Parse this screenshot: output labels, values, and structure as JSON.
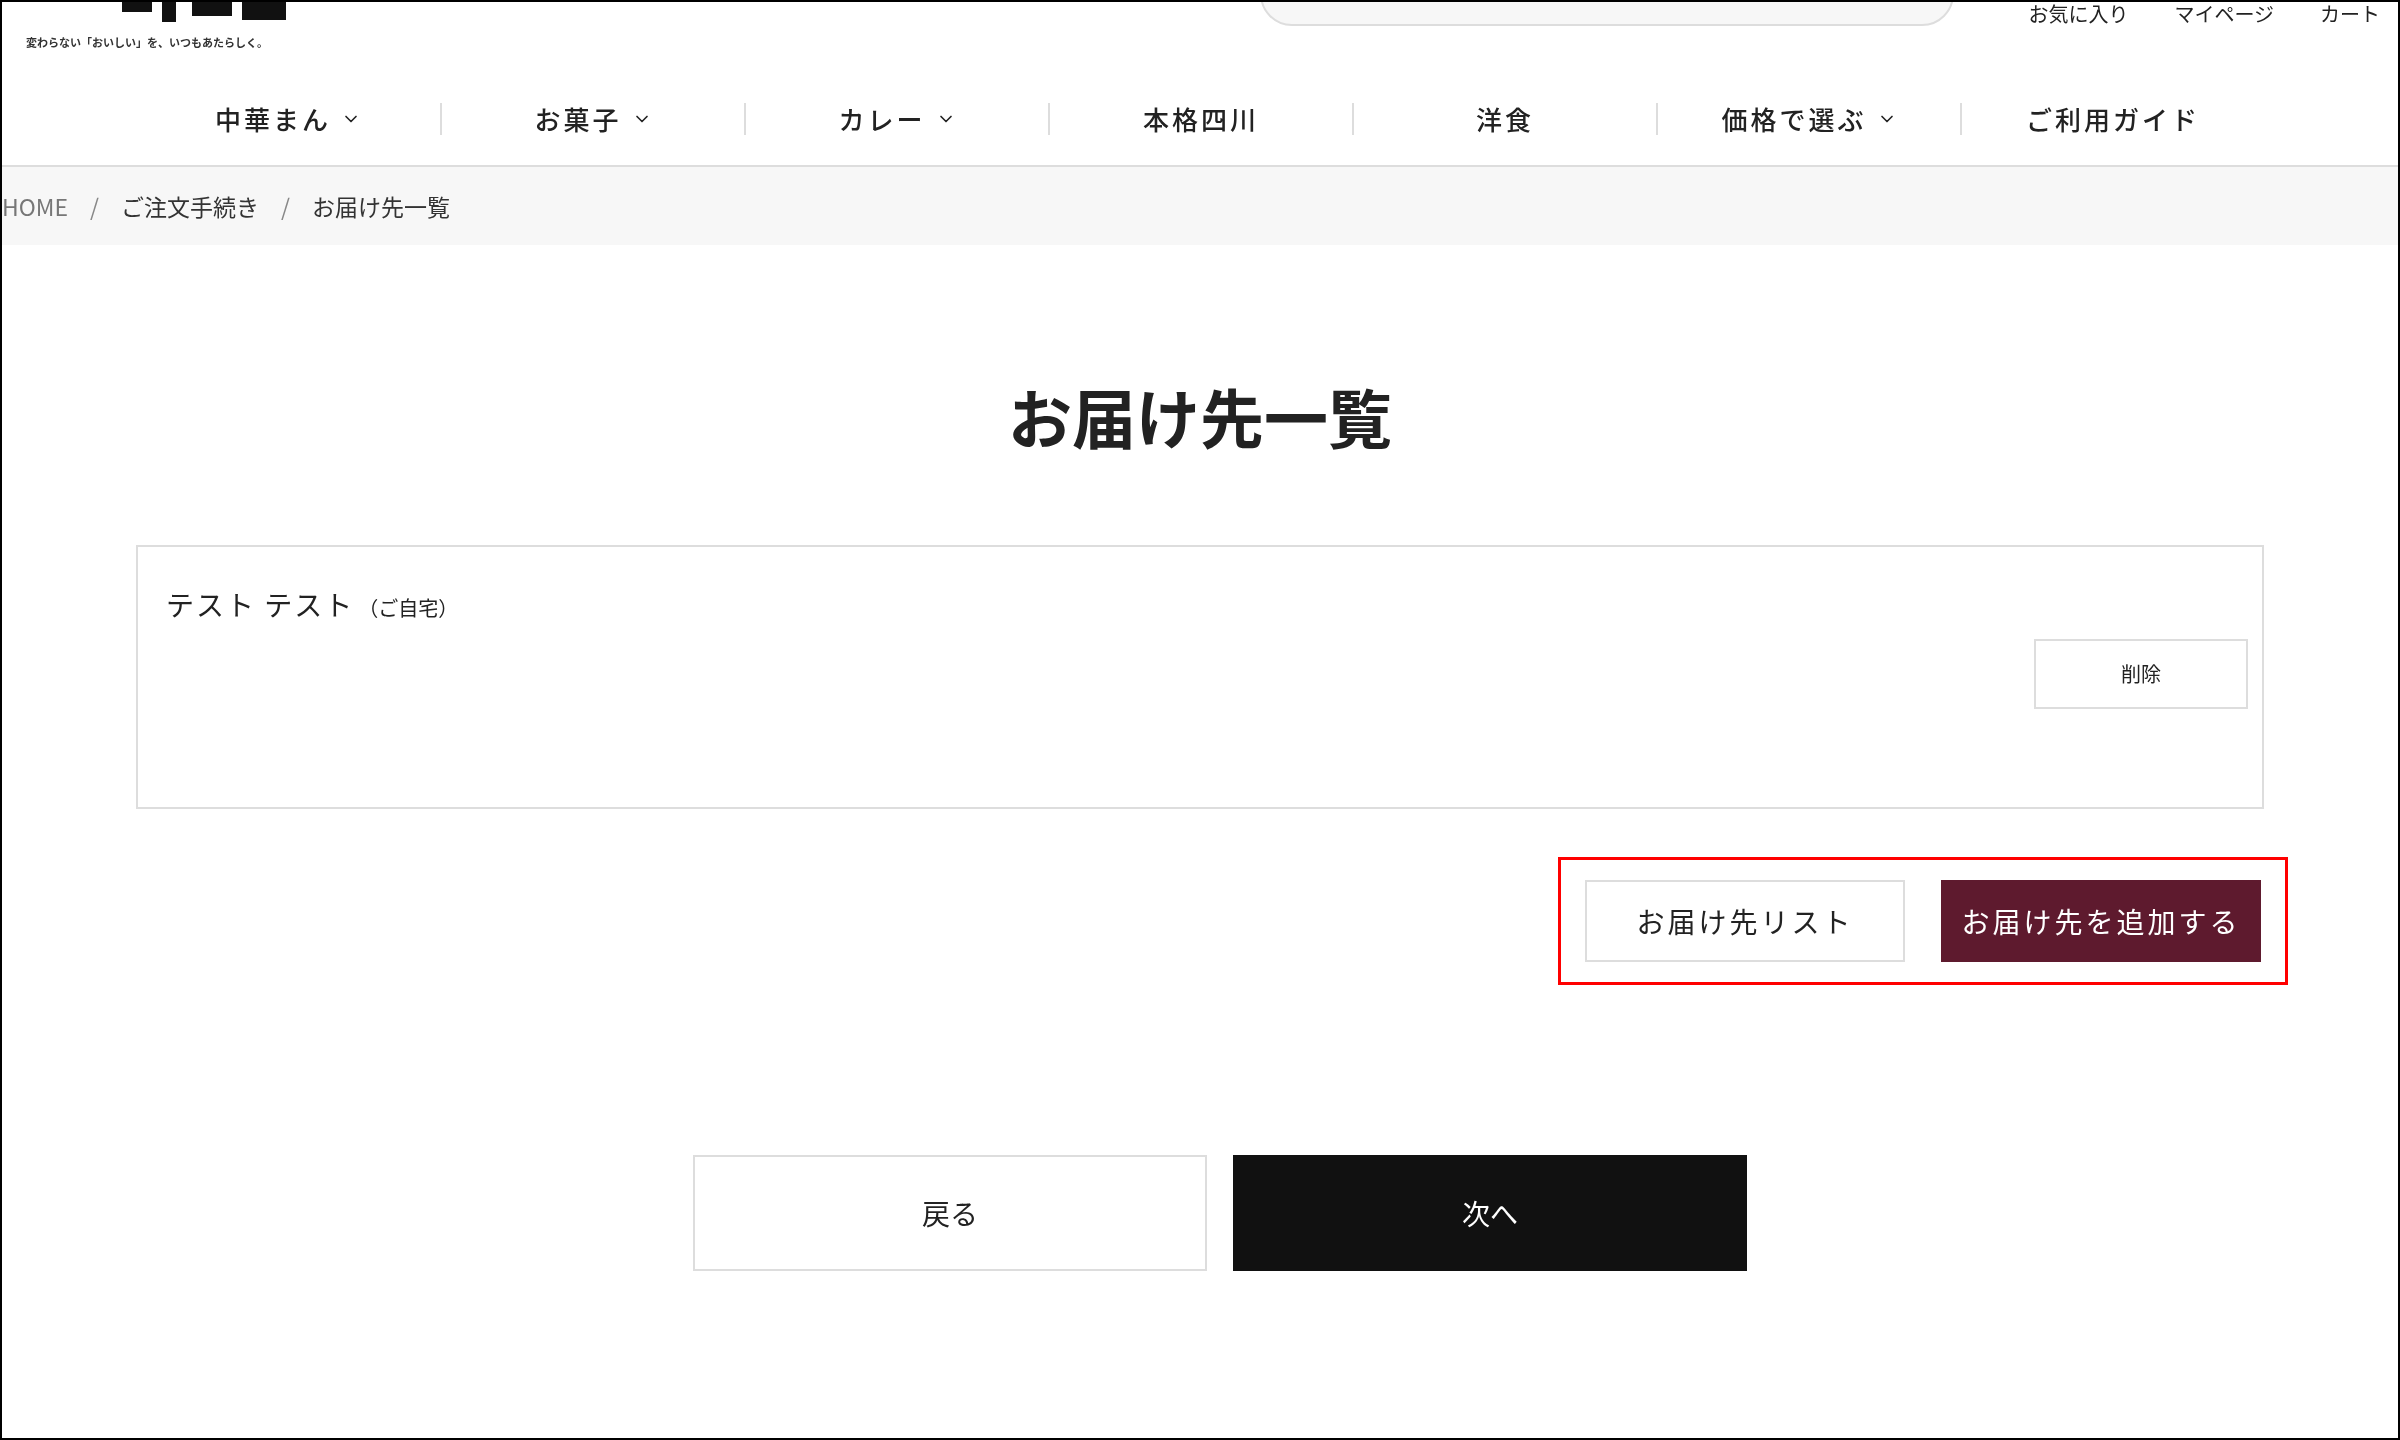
{
  "header": {
    "tagline": "変わらない「おいしい」を、いつもあたらしく。",
    "user_links": [
      "お気に入り",
      "マイページ",
      "カート"
    ]
  },
  "nav": [
    {
      "label": "中華まん",
      "dropdown": true
    },
    {
      "label": "お菓子",
      "dropdown": true
    },
    {
      "label": "カレー",
      "dropdown": true
    },
    {
      "label": "本格四川",
      "dropdown": false
    },
    {
      "label": "洋食",
      "dropdown": false
    },
    {
      "label": "価格で選ぶ",
      "dropdown": true
    },
    {
      "label": "ご利用ガイド",
      "dropdown": false
    }
  ],
  "breadcrumb": {
    "items": [
      "HOME",
      "ご注文手続き",
      "お届け先一覧"
    ],
    "separators": [
      "/",
      "/"
    ]
  },
  "title": "お届け先一覧",
  "addresses": [
    {
      "name": "テスト テスト",
      "note": "（ご自宅）",
      "delete": "削除"
    }
  ],
  "actions": {
    "list_button": "お届け先リスト",
    "add_button": "お届け先を追加する",
    "highlighted": true
  },
  "footer_buttons": {
    "back": "戻る",
    "next": "次へ"
  }
}
